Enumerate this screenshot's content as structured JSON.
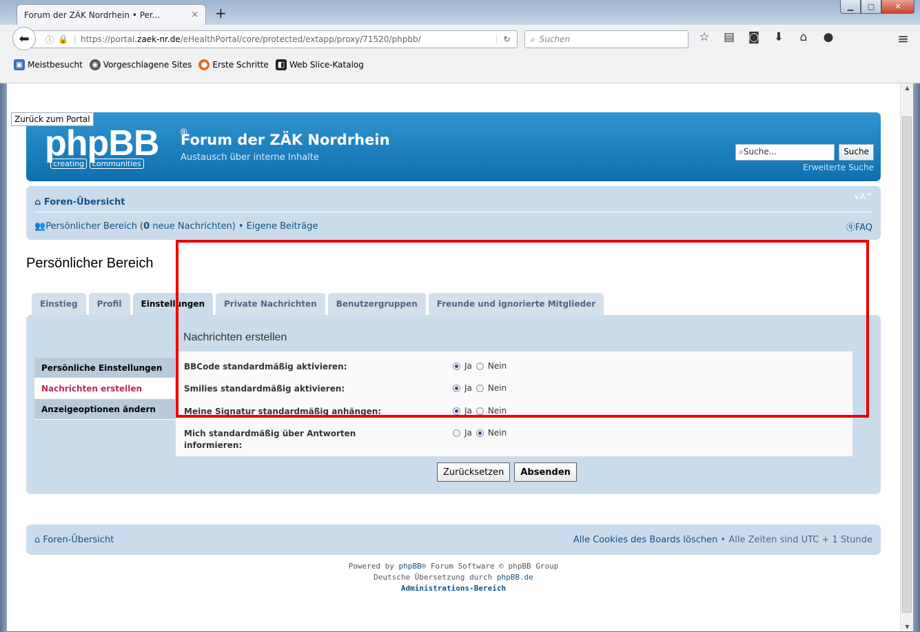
{
  "browser": {
    "tab_title": "Forum der ZÄK Nordrhein • Per...",
    "tab_close": "×",
    "new_tab": "+",
    "url_prefix": "https://portal.",
    "url_domain": "zaek-nr.de",
    "url_path": "/eHealthPortal/core/protected/extapp/proxy/71520/phpbb/",
    "search_placeholder": "Suchen",
    "bookmarks": [
      "Meistbesucht",
      "Vorgeschlagene Sites",
      "Erste Schritte",
      "Web Slice-Katalog"
    ]
  },
  "page": {
    "portal_link": "Zurück zum Portal",
    "logo_text": "phpBB",
    "logo_reg": "®",
    "logo_tag_left": "creating",
    "logo_tag_right": "communities",
    "site_name": "Forum der ZÄK Nordrhein",
    "site_desc": "Austausch über interne Inhalte",
    "search_value": "Suche...",
    "search_button": "Suche",
    "advanced_search": "Erweiterte Suche",
    "nav": {
      "index": "Foren-Übersicht",
      "font_size": "∨A^",
      "ucp_prefix": "Persönlicher Bereich (",
      "ucp_count": "0",
      "ucp_suffix": " neue Nachrichten) • Eigene Beiträge",
      "faq": "FAQ"
    },
    "title": "Persönlicher Bereich",
    "tabs": [
      "Einstieg",
      "Profil",
      "Einstellungen",
      "Private Nachrichten",
      "Benutzergruppen",
      "Freunde und ignorierte Mitglieder"
    ],
    "active_tab": "Einstellungen",
    "side_menu": [
      "Persönliche Einstellungen",
      "Nachrichten erstellen",
      "Anzeigeoptionen ändern"
    ],
    "active_side": "Nachrichten erstellen",
    "panel": {
      "title": "Nachrichten erstellen",
      "rows": [
        {
          "label": "BBCode standardmäßig aktivieren:",
          "yes": "Ja",
          "no": "Nein",
          "selected": "Ja"
        },
        {
          "label": "Smilies standardmäßig aktivieren:",
          "yes": "Ja",
          "no": "Nein",
          "selected": "Ja"
        },
        {
          "label": "Meine Signatur standardmäßig anhängen:",
          "yes": "Ja",
          "no": "Nein",
          "selected": "Ja"
        },
        {
          "label": "Mich standardmäßig über Antworten informieren:",
          "yes": "Ja",
          "no": "Nein",
          "selected": "Nein"
        }
      ],
      "reset_button": "Zurücksetzen",
      "submit_button": "Absenden"
    },
    "footer": {
      "index": "Foren-Übersicht",
      "delete_cookies": "Alle Cookies des Boards löschen",
      "timezone": " • Alle Zeiten sind UTC + 1 Stunde",
      "powered_prefix": "Powered by ",
      "powered_link": "phpBB",
      "powered_suffix": "® Forum Software © phpBB Group",
      "translation_prefix": "Deutsche Übersetzung durch ",
      "translation_link": "phpBB.de",
      "admin": "Administrations-Bereich"
    }
  },
  "colors": {
    "header_blue": "#0f6fae",
    "panel_bg": "#cadceb",
    "highlight_red": "#e00000",
    "active_menu_text": "#bc2a4d"
  }
}
